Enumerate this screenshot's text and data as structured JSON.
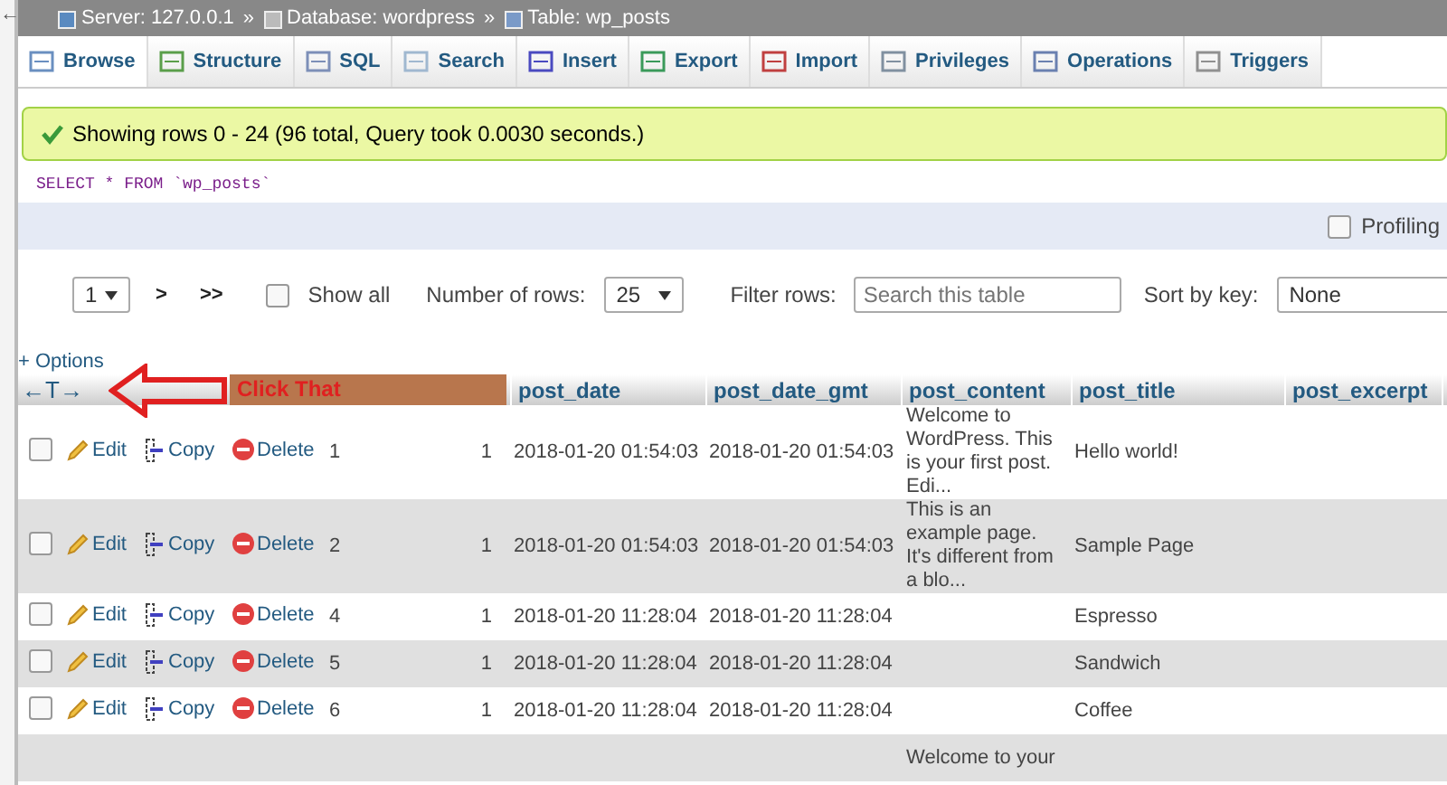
{
  "nav_toggle": "←",
  "breadcrumb": {
    "separator": "»",
    "items": [
      {
        "kind": "server",
        "label": "Server: 127.0.0.1"
      },
      {
        "kind": "database",
        "label": "Database: wordpress"
      },
      {
        "kind": "table",
        "label": "Table: wp_posts"
      }
    ]
  },
  "tabs": [
    {
      "kind": "browse",
      "label": "Browse",
      "selected": true
    },
    {
      "kind": "structure",
      "label": "Structure",
      "selected": false
    },
    {
      "kind": "sql",
      "label": "SQL",
      "selected": false
    },
    {
      "kind": "search",
      "label": "Search",
      "selected": false
    },
    {
      "kind": "insert",
      "label": "Insert",
      "selected": false
    },
    {
      "kind": "export",
      "label": "Export",
      "selected": false
    },
    {
      "kind": "import",
      "label": "Import",
      "selected": false
    },
    {
      "kind": "privileges",
      "label": "Privileges",
      "selected": false
    },
    {
      "kind": "operations",
      "label": "Operations",
      "selected": false
    },
    {
      "kind": "triggers",
      "label": "Triggers",
      "selected": false
    }
  ],
  "message": "Showing rows 0 - 24 (96 total, Query took 0.0030 seconds.)",
  "sql": "SELECT * FROM `wp_posts`",
  "profiling": {
    "label": "Profiling",
    "checked": false
  },
  "pager": {
    "page": "1",
    "next": ">",
    "last": ">>"
  },
  "show_all": {
    "label": "Show all",
    "checked": false
  },
  "rows_label": "Number of rows:",
  "rows_value": "25",
  "filter_label": "Filter rows:",
  "filter_placeholder": "Search this table",
  "sort_label": "Sort by key:",
  "sort_value": "None",
  "options": "+ Options",
  "column_toggle": "←T→",
  "annotation": "Click That",
  "columns": [
    "post_date",
    "post_date_gmt",
    "post_content",
    "post_title",
    "post_excerpt"
  ],
  "rows": [
    {
      "checked": false,
      "edit": "Edit",
      "copy": "Copy",
      "delete": "Delete",
      "id": "1",
      "author": "1",
      "post_date": "2018-01-20 01:54:03",
      "post_date_gmt": "2018-01-20 01:54:03",
      "post_content": "Welcome to WordPress. This is your first post. Edi...",
      "post_title": "Hello world!"
    },
    {
      "checked": false,
      "edit": "Edit",
      "copy": "Copy",
      "delete": "Delete",
      "id": "2",
      "author": "1",
      "post_date": "2018-01-20 01:54:03",
      "post_date_gmt": "2018-01-20 01:54:03",
      "post_content": "This is an example page. It's different from a blo...",
      "post_title": "Sample Page"
    },
    {
      "checked": false,
      "edit": "Edit",
      "copy": "Copy",
      "delete": "Delete",
      "id": "4",
      "author": "1",
      "post_date": "2018-01-20 11:28:04",
      "post_date_gmt": "2018-01-20 11:28:04",
      "post_title": "Espresso"
    },
    {
      "checked": false,
      "edit": "Edit",
      "copy": "Copy",
      "delete": "Delete",
      "id": "5",
      "author": "1",
      "post_date": "2018-01-20 11:28:04",
      "post_date_gmt": "2018-01-20 11:28:04",
      "post_title": "Sandwich"
    },
    {
      "checked": false,
      "edit": "Edit",
      "copy": "Copy",
      "delete": "Delete",
      "id": "6",
      "author": "1",
      "post_date": "2018-01-20 11:28:04",
      "post_date_gmt": "2018-01-20 11:28:04",
      "post_title": "Coffee"
    },
    {
      "post_content": "Welcome to your"
    }
  ]
}
